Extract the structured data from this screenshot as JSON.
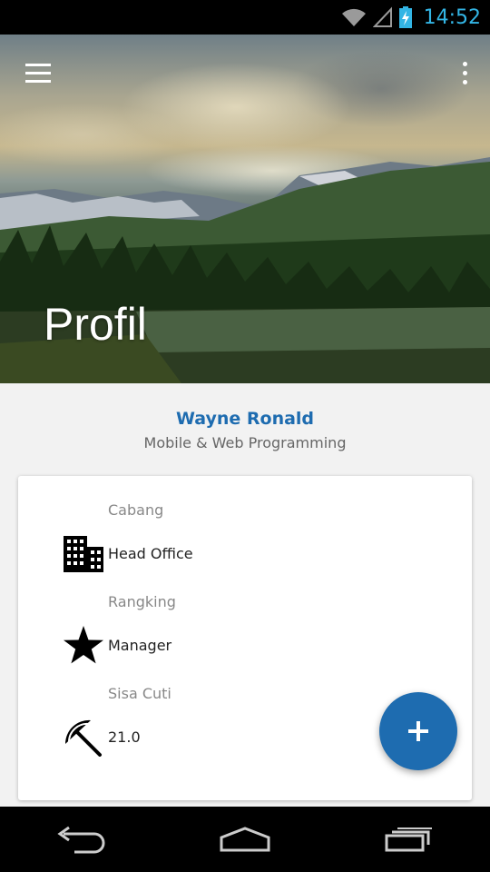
{
  "status_bar": {
    "time": "14:52",
    "icons": [
      "wifi-icon",
      "signal-icon",
      "battery-charging-icon"
    ]
  },
  "header": {
    "title": "Profil",
    "menu_icon": "hamburger-menu-icon",
    "more_icon": "more-vert-icon"
  },
  "profile": {
    "name": "Wayne Ronald",
    "role": "Mobile & Web Programming"
  },
  "details": {
    "cabang_label": "Cabang",
    "cabang_value": "Head Office",
    "rangking_label": "Rangking",
    "rangking_value": "Manager",
    "cuti_label": "Sisa Cuti",
    "cuti_value": "21.0"
  },
  "fab": {
    "icon": "add-icon"
  },
  "colors": {
    "accent": "#1e6cb0",
    "status_time": "#33b5e5"
  },
  "nav_bar": {
    "icons": [
      "back-icon",
      "home-icon",
      "recent-apps-icon"
    ]
  }
}
